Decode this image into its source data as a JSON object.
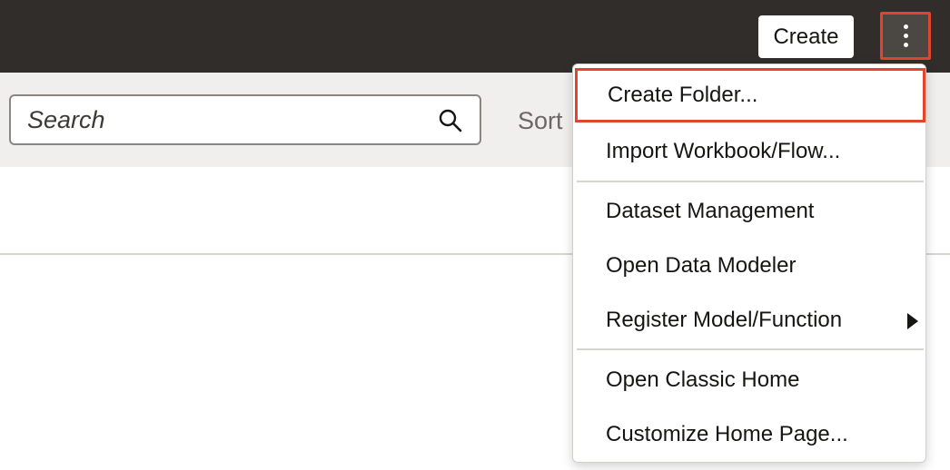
{
  "header": {
    "create_label": "Create",
    "more_icon": "kebab-vertical-icon"
  },
  "toolbar": {
    "search_placeholder": "Search",
    "search_icon": "search-icon",
    "sort_label": "Sort"
  },
  "menu": {
    "items": [
      {
        "label": "Create Folder..."
      },
      {
        "label": "Import Workbook/Flow..."
      },
      {
        "label": "Dataset Management"
      },
      {
        "label": "Open Data Modeler"
      },
      {
        "label": "Register Model/Function",
        "submenu_icon": "chevron-right-icon"
      },
      {
        "label": "Open Classic Home"
      },
      {
        "label": "Customize Home Page..."
      }
    ]
  },
  "colors": {
    "topbar": "#312d2a",
    "highlight": "#e0462d",
    "search_band": "#f1efed"
  }
}
